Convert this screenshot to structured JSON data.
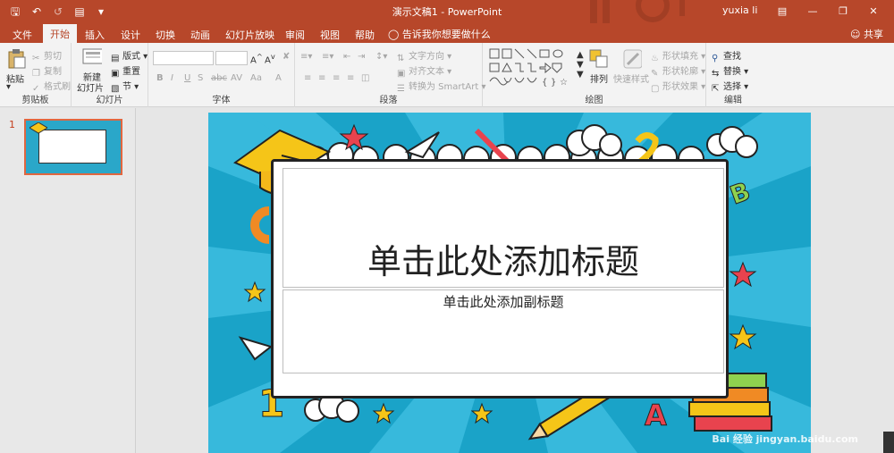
{
  "titlebar": {
    "title": "演示文稿1  -  PowerPoint",
    "user": "yuxia li",
    "qat": [
      "save-icon",
      "undo-icon",
      "redo-icon",
      "present-icon",
      "customize-icon"
    ]
  },
  "tabs": [
    "文件",
    "开始",
    "插入",
    "设计",
    "切换",
    "动画",
    "幻灯片放映",
    "审阅",
    "视图",
    "帮助"
  ],
  "active_tab": "开始",
  "tell_me": "告诉我你想要做什么",
  "share": "共享",
  "ribbon": {
    "clipboard": {
      "label": "剪贴板",
      "paste": "粘贴",
      "cut": "剪切",
      "copy": "复制",
      "format_painter": "格式刷"
    },
    "slides": {
      "label": "幻灯片",
      "new_slide_1": "新建",
      "new_slide_2": "幻灯片",
      "layout": "版式",
      "reset": "重置",
      "section": "节"
    },
    "font": {
      "label": "字体",
      "bold": "B",
      "italic": "I",
      "underline": "U",
      "strike": "S",
      "spacing": "AV",
      "case": "Aa",
      "grow": "A",
      "shrink": "A"
    },
    "paragraph": {
      "label": "段落",
      "text_direction": "文字方向",
      "align_text": "对齐文本",
      "smartart": "转换为 SmartArt"
    },
    "drawing": {
      "label": "绘图",
      "arrange": "排列",
      "quick_styles": "快速样式",
      "fill": "形状填充",
      "outline": "形状轮廓",
      "effects": "形状效果"
    },
    "editing": {
      "label": "编辑",
      "find": "查找",
      "replace": "替换",
      "select": "选择"
    }
  },
  "thumbnails": [
    {
      "number": "1"
    }
  ],
  "slide": {
    "title_placeholder": "单击此处添加标题",
    "subtitle_placeholder": "单击此处添加副标题"
  },
  "watermark": "Bai 经验 jingyan.baidu.com",
  "colors": {
    "accent": "#b7472a",
    "ribbon": "#f3f3f3",
    "slide_bg": "#1aa3c8"
  }
}
